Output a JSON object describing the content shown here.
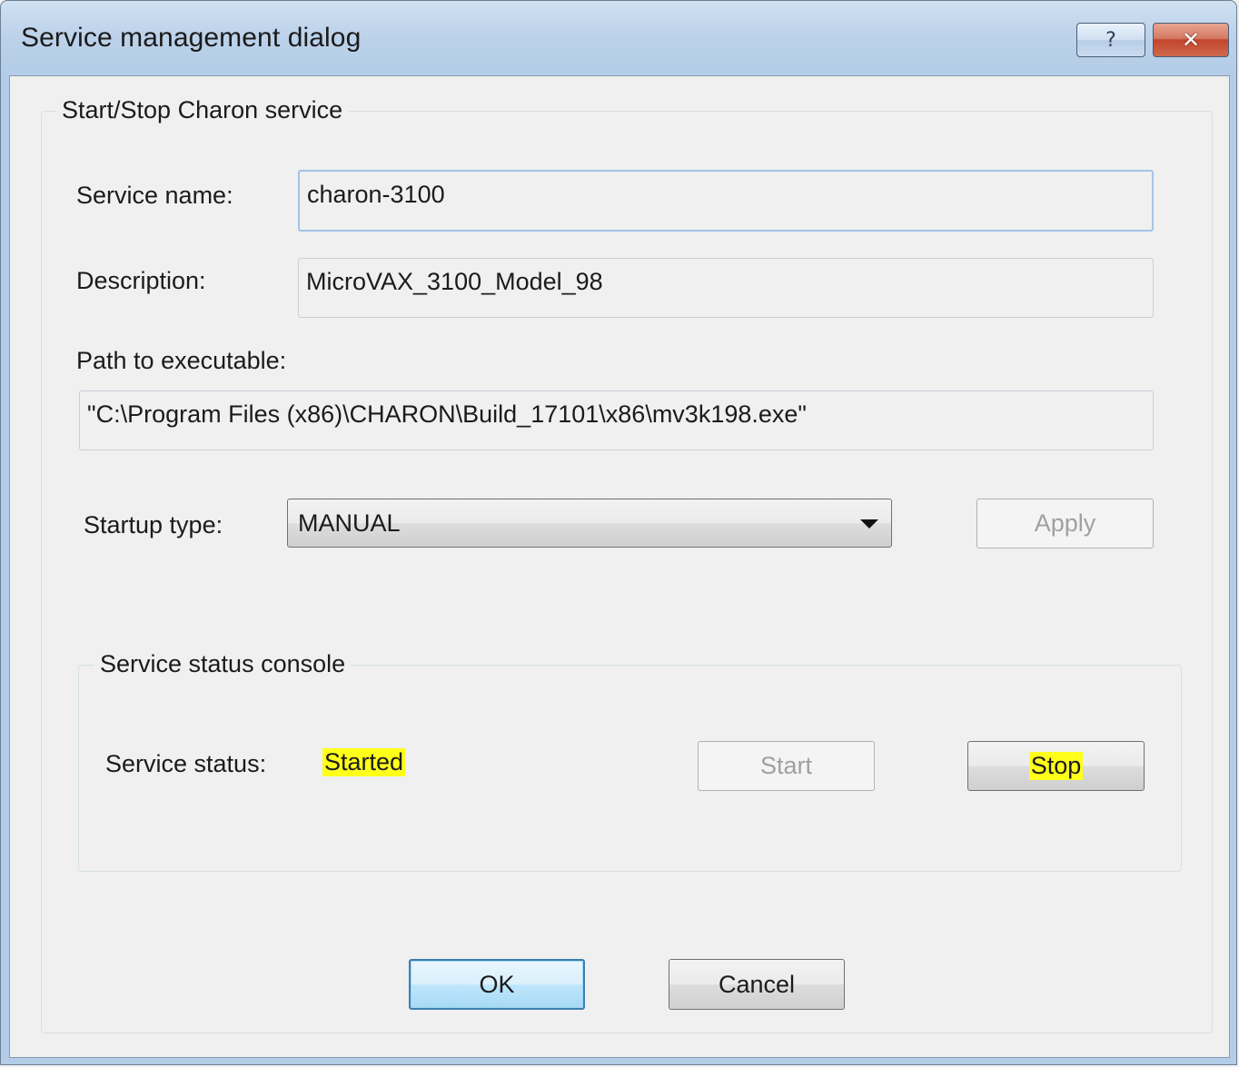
{
  "window": {
    "title": "Service management dialog",
    "help_symbol": "?",
    "close_symbol": "✕"
  },
  "service_group": {
    "title": "Start/Stop Charon service",
    "service_name_label": "Service name:",
    "service_name_value": "charon-3100",
    "description_label": "Description:",
    "description_value": "MicroVAX_3100_Model_98",
    "path_label": "Path to executable:",
    "path_value": "\"C:\\Program Files (x86)\\CHARON\\Build_17101\\x86\\mv3k198.exe\"",
    "startup_type_label": "Startup type:",
    "startup_type_value": "MANUAL",
    "apply_label": "Apply"
  },
  "status_group": {
    "title": "Service status console",
    "status_label": "Service status:",
    "status_value": "Started",
    "start_label": "Start",
    "stop_label": "Stop",
    "highlight_color": "#ffff1a"
  },
  "footer": {
    "ok_label": "OK",
    "cancel_label": "Cancel"
  }
}
